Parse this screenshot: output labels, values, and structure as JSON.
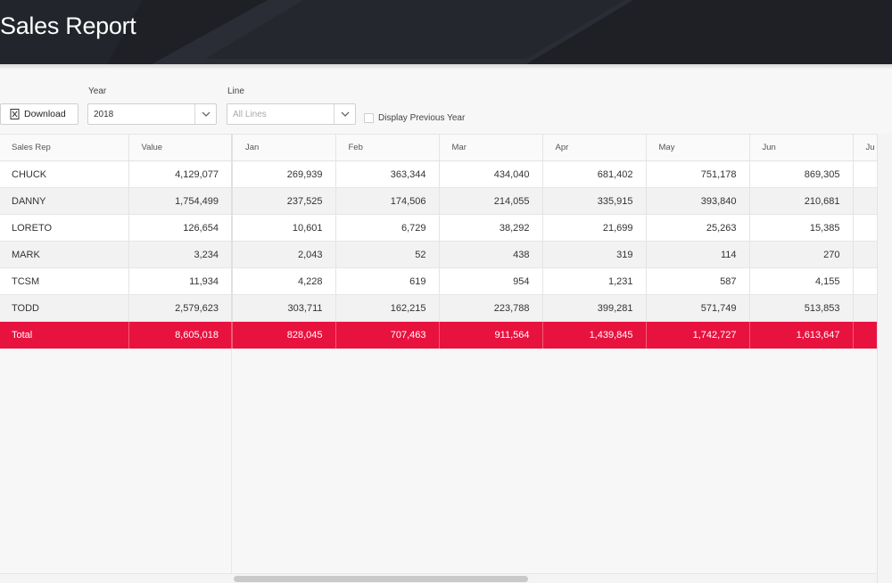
{
  "header": {
    "title": "Sales Report"
  },
  "controls": {
    "download_label": "Download",
    "year_label": "Year",
    "year_value": "2018",
    "line_label": "Line",
    "line_placeholder": "All Lines",
    "prev_year_label": "Display Previous Year",
    "prev_year_checked": false
  },
  "table": {
    "columns": [
      "Sales Rep",
      "Value",
      "Jan",
      "Feb",
      "Mar",
      "Apr",
      "May",
      "Jun",
      "Ju"
    ],
    "rows": [
      [
        "CHUCK",
        "4,129,077",
        "269,939",
        "363,344",
        "434,040",
        "681,402",
        "751,178",
        "869,305",
        ""
      ],
      [
        "DANNY",
        "1,754,499",
        "237,525",
        "174,506",
        "214,055",
        "335,915",
        "393,840",
        "210,681",
        ""
      ],
      [
        "LORETO",
        "126,654",
        "10,601",
        "6,729",
        "38,292",
        "21,699",
        "25,263",
        "15,385",
        ""
      ],
      [
        "MARK",
        "3,234",
        "2,043",
        "52",
        "438",
        "319",
        "114",
        "270",
        ""
      ],
      [
        "TCSM",
        "11,934",
        "4,228",
        "619",
        "954",
        "1,231",
        "587",
        "4,155",
        ""
      ],
      [
        "TODD",
        "2,579,623",
        "303,711",
        "162,215",
        "223,788",
        "399,281",
        "571,749",
        "513,853",
        ""
      ]
    ],
    "total": [
      "Total",
      "8,605,018",
      "828,045",
      "707,463",
      "911,564",
      "1,439,845",
      "1,742,727",
      "1,613,647",
      ""
    ]
  },
  "colors": {
    "header_bg": "#1e2026",
    "total_row": "#e8123f"
  }
}
